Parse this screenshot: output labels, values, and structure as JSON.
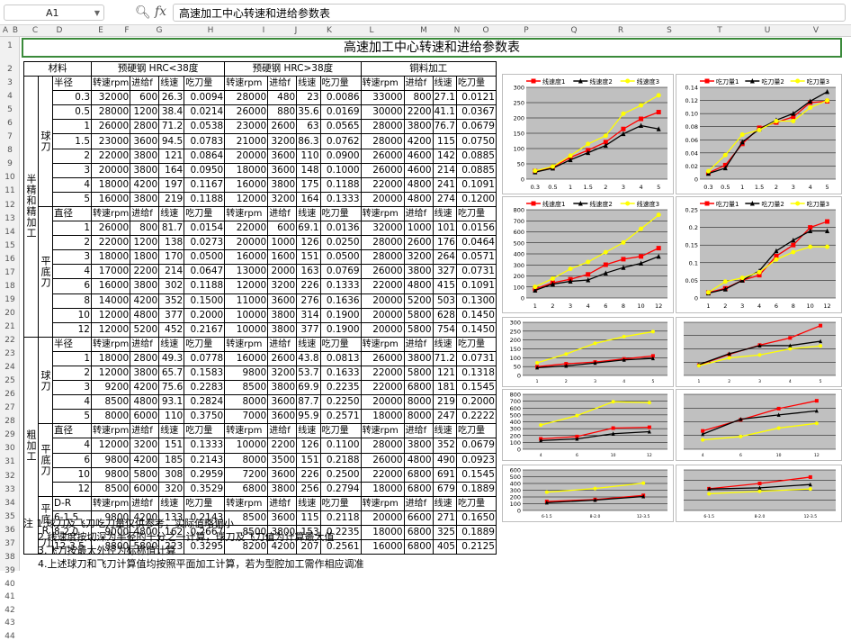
{
  "formula_bar": {
    "cell_ref": "A1",
    "content": "高速加工中心转速和进给参数表"
  },
  "columns": [
    "A",
    "B",
    "C",
    "D",
    "E",
    "F",
    "G",
    "H",
    "I",
    "J",
    "K",
    "L",
    "M",
    "N",
    "O",
    "P",
    "Q",
    "R",
    "S",
    "T",
    "U",
    "V"
  ],
  "rows": [
    "1",
    "2",
    "3",
    "4",
    "5",
    "6",
    "7",
    "8",
    "9",
    "10",
    "11",
    "12",
    "13",
    "14",
    "15",
    "16",
    "17",
    "18",
    "19",
    "20",
    "21",
    "22",
    "23",
    "24",
    "25",
    "26",
    "27",
    "28",
    "29",
    "30",
    "31",
    "32",
    "33",
    "34",
    "35",
    "36",
    "37",
    "38",
    "39",
    "40",
    "41",
    "42",
    "43",
    "44"
  ],
  "sheet": {
    "title": "高速加工中心转速和进给参数表",
    "header": {
      "material": "材料",
      "g1": "预硬钢 HRC<38度",
      "g2": "预硬钢 HRC>38度",
      "g3": "铜料加工"
    },
    "sub_headers": [
      "转速rpm",
      "进给f",
      "线速",
      "吃刀量"
    ],
    "group_labels": {
      "semi": "半精和精加工",
      "rough": "粗加工",
      "ball": "球刀",
      "flat": "平底刀",
      "flat_r": "平底R刀"
    },
    "col_labels": {
      "radius": "半径",
      "diameter": "直径",
      "dr": "D-R"
    },
    "semi_ball": [
      [
        "0.3",
        "32000",
        "600",
        "26.3",
        "0.0094",
        "28000",
        "480",
        "23",
        "0.0086",
        "33000",
        "800",
        "27.1",
        "0.0121"
      ],
      [
        "0.5",
        "28000",
        "1200",
        "38.4",
        "0.0214",
        "26000",
        "880",
        "35.6",
        "0.0169",
        "30000",
        "2200",
        "41.1",
        "0.0367"
      ],
      [
        "1",
        "26000",
        "2800",
        "71.2",
        "0.0538",
        "23000",
        "2600",
        "63",
        "0.0565",
        "28000",
        "3800",
        "76.7",
        "0.0679"
      ],
      [
        "1.5",
        "23000",
        "3600",
        "94.5",
        "0.0783",
        "21000",
        "3200",
        "86.3",
        "0.0762",
        "28000",
        "4200",
        "115",
        "0.0750"
      ],
      [
        "2",
        "22000",
        "3800",
        "121",
        "0.0864",
        "20000",
        "3600",
        "110",
        "0.0900",
        "26000",
        "4600",
        "142",
        "0.0885"
      ],
      [
        "3",
        "20000",
        "3800",
        "164",
        "0.0950",
        "18000",
        "3600",
        "148",
        "0.1000",
        "26000",
        "4600",
        "214",
        "0.0885"
      ],
      [
        "4",
        "18000",
        "4200",
        "197",
        "0.1167",
        "16000",
        "3800",
        "175",
        "0.1188",
        "22000",
        "4800",
        "241",
        "0.1091"
      ],
      [
        "5",
        "16000",
        "3800",
        "219",
        "0.1188",
        "12000",
        "3200",
        "164",
        "0.1333",
        "20000",
        "4800",
        "274",
        "0.1200"
      ]
    ],
    "semi_flat": [
      [
        "1",
        "26000",
        "800",
        "81.7",
        "0.0154",
        "22000",
        "600",
        "69.1",
        "0.0136",
        "32000",
        "1000",
        "101",
        "0.0156"
      ],
      [
        "2",
        "22000",
        "1200",
        "138",
        "0.0273",
        "20000",
        "1000",
        "126",
        "0.0250",
        "28000",
        "2600",
        "176",
        "0.0464"
      ],
      [
        "3",
        "18000",
        "1800",
        "170",
        "0.0500",
        "16000",
        "1600",
        "151",
        "0.0500",
        "28000",
        "3200",
        "264",
        "0.0571"
      ],
      [
        "4",
        "17000",
        "2200",
        "214",
        "0.0647",
        "13000",
        "2000",
        "163",
        "0.0769",
        "26000",
        "3800",
        "327",
        "0.0731"
      ],
      [
        "6",
        "16000",
        "3800",
        "302",
        "0.1188",
        "12000",
        "3200",
        "226",
        "0.1333",
        "22000",
        "4800",
        "415",
        "0.1091"
      ],
      [
        "8",
        "14000",
        "4200",
        "352",
        "0.1500",
        "11000",
        "3600",
        "276",
        "0.1636",
        "20000",
        "5200",
        "503",
        "0.1300"
      ],
      [
        "10",
        "12000",
        "4800",
        "377",
        "0.2000",
        "10000",
        "3800",
        "314",
        "0.1900",
        "20000",
        "5800",
        "628",
        "0.1450"
      ],
      [
        "12",
        "12000",
        "5200",
        "452",
        "0.2167",
        "10000",
        "3800",
        "377",
        "0.1900",
        "20000",
        "5800",
        "754",
        "0.1450"
      ]
    ],
    "rough_ball": [
      [
        "1",
        "18000",
        "2800",
        "49.3",
        "0.0778",
        "16000",
        "2600",
        "43.8",
        "0.0813",
        "26000",
        "3800",
        "71.2",
        "0.0731"
      ],
      [
        "2",
        "12000",
        "3800",
        "65.7",
        "0.1583",
        "9800",
        "3200",
        "53.7",
        "0.1633",
        "22000",
        "5800",
        "121",
        "0.1318"
      ],
      [
        "3",
        "9200",
        "4200",
        "75.6",
        "0.2283",
        "8500",
        "3800",
        "69.9",
        "0.2235",
        "22000",
        "6800",
        "181",
        "0.1545"
      ],
      [
        "4",
        "8500",
        "4800",
        "93.1",
        "0.2824",
        "8000",
        "3600",
        "87.7",
        "0.2250",
        "20000",
        "8000",
        "219",
        "0.2000"
      ],
      [
        "5",
        "8000",
        "6000",
        "110",
        "0.3750",
        "7000",
        "3600",
        "95.9",
        "0.2571",
        "18000",
        "8000",
        "247",
        "0.2222"
      ]
    ],
    "rough_flat": [
      [
        "4",
        "12000",
        "3200",
        "151",
        "0.1333",
        "10000",
        "2200",
        "126",
        "0.1100",
        "28000",
        "3800",
        "352",
        "0.0679"
      ],
      [
        "6",
        "9800",
        "4200",
        "185",
        "0.2143",
        "8000",
        "3500",
        "151",
        "0.2188",
        "26000",
        "4800",
        "490",
        "0.0923"
      ],
      [
        "10",
        "9800",
        "5800",
        "308",
        "0.2959",
        "7200",
        "3600",
        "226",
        "0.2500",
        "22000",
        "6800",
        "691",
        "0.1545"
      ],
      [
        "12",
        "8500",
        "6000",
        "320",
        "0.3529",
        "6800",
        "3800",
        "256",
        "0.2794",
        "18000",
        "6800",
        "679",
        "0.1889"
      ]
    ],
    "rough_flatr": [
      [
        "6-1.5",
        "9800",
        "4200",
        "133",
        "0.2143",
        "8500",
        "3600",
        "115",
        "0.2118",
        "20000",
        "6600",
        "271",
        "0.1650"
      ],
      [
        "8-2.0",
        "9000",
        "4800",
        "162",
        "0.2667",
        "8500",
        "3800",
        "153",
        "0.2235",
        "18000",
        "6800",
        "325",
        "0.1889"
      ],
      [
        "12-3.5",
        "8800",
        "5800",
        "223",
        "0.3295",
        "8200",
        "4200",
        "207",
        "0.2561",
        "16000",
        "6800",
        "405",
        "0.2125"
      ]
    ],
    "notes": [
      "注 1.球刀及飞刀吃刀量仅供参考，实际值略偏小",
      "2.线速度按切深为半径的十分之一计算，球刀及飞刀值为计算最大值",
      "3.飞刀按最大外径为标称值计算",
      "4.上述球刀和飞刀计算值均按照平面加工计算，若为型腔加工需作相应调准"
    ]
  },
  "colors": {
    "s1": "#ff0000",
    "s2": "#000000",
    "s3": "#ffff00",
    "plot_bg": "#c0c0c0",
    "title_border": "#3a8a3a"
  },
  "chart_data": [
    {
      "type": "line",
      "categories": [
        "0.3",
        "0.5",
        "1",
        "1.5",
        "2",
        "3",
        "4",
        "5"
      ],
      "series": [
        {
          "name": "线速度1",
          "values": [
            26.3,
            38.4,
            71.2,
            94.5,
            121,
            164,
            197,
            219
          ]
        },
        {
          "name": "线速度2",
          "values": [
            23,
            35.6,
            63,
            86.3,
            110,
            148,
            175,
            164
          ]
        },
        {
          "name": "线速度3",
          "values": [
            27.1,
            41.1,
            76.7,
            115,
            142,
            214,
            241,
            274
          ]
        }
      ],
      "ylim": [
        0,
        300
      ],
      "yticks": [
        0,
        50,
        100,
        150,
        200,
        250,
        300
      ],
      "ytick_labels": [
        "0",
        "50",
        "100",
        "150",
        "200",
        "250",
        "300"
      ],
      "grid": true,
      "legend": "top"
    },
    {
      "type": "line",
      "categories": [
        "0.3",
        "0.5",
        "1",
        "1.5",
        "2",
        "3",
        "4",
        "5"
      ],
      "series": [
        {
          "name": "吃刀量1",
          "values": [
            0.0094,
            0.0214,
            0.0538,
            0.0783,
            0.0864,
            0.095,
            0.1167,
            0.1188
          ]
        },
        {
          "name": "吃刀量2",
          "values": [
            0.0086,
            0.0169,
            0.0565,
            0.0762,
            0.09,
            0.1,
            0.1188,
            0.1333
          ]
        },
        {
          "name": "吃刀量3",
          "values": [
            0.0121,
            0.0367,
            0.0679,
            0.075,
            0.0885,
            0.0885,
            0.1091,
            0.12
          ]
        }
      ],
      "ylim": [
        0,
        0.14
      ],
      "yticks": [
        0,
        0.02,
        0.04,
        0.06,
        0.08,
        0.1,
        0.12,
        0.14
      ],
      "ytick_labels": [
        "0",
        "0.02",
        "0.04",
        "0.06",
        "0.08",
        "0.10",
        "0.12",
        "0.14"
      ],
      "grid": true,
      "legend": "top"
    },
    {
      "type": "line",
      "categories": [
        "1",
        "2",
        "3",
        "4",
        "6",
        "8",
        "10",
        "12"
      ],
      "series": [
        {
          "name": "线速度1",
          "values": [
            81.7,
            138,
            170,
            214,
            302,
            352,
            377,
            452
          ]
        },
        {
          "name": "线速度2",
          "values": [
            69.1,
            126,
            151,
            163,
            226,
            276,
            314,
            377
          ]
        },
        {
          "name": "线速度3",
          "values": [
            101,
            176,
            264,
            327,
            415,
            503,
            628,
            754
          ]
        }
      ],
      "ylim": [
        0,
        800
      ],
      "yticks": [
        0,
        100,
        200,
        300,
        400,
        500,
        600,
        700,
        800
      ],
      "ytick_labels": [
        "0",
        "100",
        "200",
        "300",
        "400",
        "500",
        "600",
        "700",
        "800"
      ],
      "grid": true,
      "legend": "top"
    },
    {
      "type": "line",
      "categories": [
        "1",
        "2",
        "3",
        "4",
        "6",
        "8",
        "10",
        "12"
      ],
      "series": [
        {
          "name": "吃刀量1",
          "values": [
            0.0154,
            0.0273,
            0.05,
            0.0647,
            0.1188,
            0.15,
            0.2,
            0.2167
          ]
        },
        {
          "name": "吃刀量2",
          "values": [
            0.0136,
            0.025,
            0.05,
            0.0769,
            0.1333,
            0.1636,
            0.19,
            0.19
          ]
        },
        {
          "name": "吃刀量3",
          "values": [
            0.0156,
            0.0464,
            0.0571,
            0.0731,
            0.1091,
            0.13,
            0.145,
            0.145
          ]
        }
      ],
      "ylim": [
        0,
        0.25
      ],
      "yticks": [
        0,
        0.05,
        0.1,
        0.15,
        0.2,
        0.25
      ],
      "ytick_labels": [
        "0",
        "0.05",
        "0.1",
        "0.15",
        "0.2",
        "0.25"
      ],
      "grid": true,
      "legend": "top"
    },
    {
      "type": "line",
      "categories": [
        "1",
        "2",
        "3",
        "4",
        "5"
      ],
      "series": [
        {
          "values": [
            49.3,
            65.7,
            75.6,
            93.1,
            110
          ]
        },
        {
          "values": [
            43.8,
            53.7,
            69.9,
            87.7,
            95.9
          ]
        },
        {
          "values": [
            71.2,
            121,
            181,
            219,
            247
          ]
        }
      ],
      "ylim": [
        0,
        300
      ],
      "yticks": [
        0,
        50,
        100,
        150,
        200,
        250,
        300
      ],
      "ytick_labels": [
        "0",
        "50",
        "100",
        "150",
        "200",
        "250",
        "300"
      ],
      "grid": true
    },
    {
      "type": "line",
      "categories": [
        "1",
        "2",
        "3",
        "4",
        "5"
      ],
      "series": [
        {
          "values": [
            0.0778,
            0.1583,
            0.2283,
            0.2824,
            0.375
          ]
        },
        {
          "values": [
            0.0813,
            0.1633,
            0.2235,
            0.225,
            0.2571
          ]
        },
        {
          "values": [
            0.0731,
            0.1318,
            0.1545,
            0.2,
            0.2222
          ]
        }
      ],
      "ylim": [
        0,
        0.4
      ],
      "yticks": [
        0,
        0.1,
        0.2,
        0.3,
        0.4
      ],
      "ytick_labels": [
        "",
        "",
        "",
        "",
        ""
      ],
      "grid": true
    },
    {
      "type": "line",
      "categories": [
        "4",
        "6",
        "10",
        "12"
      ],
      "series": [
        {
          "values": [
            151,
            185,
            308,
            320
          ]
        },
        {
          "values": [
            126,
            151,
            226,
            256
          ]
        },
        {
          "values": [
            352,
            490,
            691,
            679
          ]
        }
      ],
      "ylim": [
        0,
        800
      ],
      "yticks": [
        0,
        100,
        200,
        300,
        400,
        500,
        600,
        700,
        800
      ],
      "ytick_labels": [
        "0",
        "100",
        "200",
        "300",
        "400",
        "500",
        "600",
        "700",
        "800"
      ],
      "grid": true
    },
    {
      "type": "line",
      "categories": [
        "4",
        "6",
        "10",
        "12"
      ],
      "series": [
        {
          "values": [
            0.1333,
            0.2143,
            0.2959,
            0.3529
          ]
        },
        {
          "values": [
            0.11,
            0.2188,
            0.25,
            0.2794
          ]
        },
        {
          "values": [
            0.0679,
            0.0923,
            0.1545,
            0.1889
          ]
        }
      ],
      "ylim": [
        0,
        0.4
      ],
      "yticks": [
        0,
        0.1,
        0.2,
        0.3,
        0.4
      ],
      "ytick_labels": [
        "",
        "",
        "",
        "",
        ""
      ],
      "grid": true
    },
    {
      "type": "line",
      "categories": [
        "6-1.5",
        "8-2.0",
        "12-3.5"
      ],
      "series": [
        {
          "values": [
            133,
            162,
            223
          ]
        },
        {
          "values": [
            115,
            153,
            207
          ]
        },
        {
          "values": [
            271,
            325,
            405
          ]
        }
      ],
      "ylim": [
        0,
        600
      ],
      "yticks": [
        0,
        100,
        200,
        300,
        400,
        500,
        600
      ],
      "ytick_labels": [
        "0",
        "100",
        "200",
        "300",
        "400",
        "500",
        "600"
      ],
      "grid": true
    },
    {
      "type": "line",
      "categories": [
        "6-1.5",
        "8-2.0",
        "12-3.5"
      ],
      "series": [
        {
          "values": [
            0.2143,
            0.2667,
            0.3295
          ]
        },
        {
          "values": [
            0.2118,
            0.2235,
            0.2561
          ]
        },
        {
          "values": [
            0.165,
            0.1889,
            0.2125
          ]
        }
      ],
      "ylim": [
        0,
        0.4
      ],
      "yticks": [
        0,
        0.1,
        0.2,
        0.3,
        0.4
      ],
      "ytick_labels": [
        "",
        "",
        "",
        "",
        ""
      ],
      "grid": true
    }
  ]
}
